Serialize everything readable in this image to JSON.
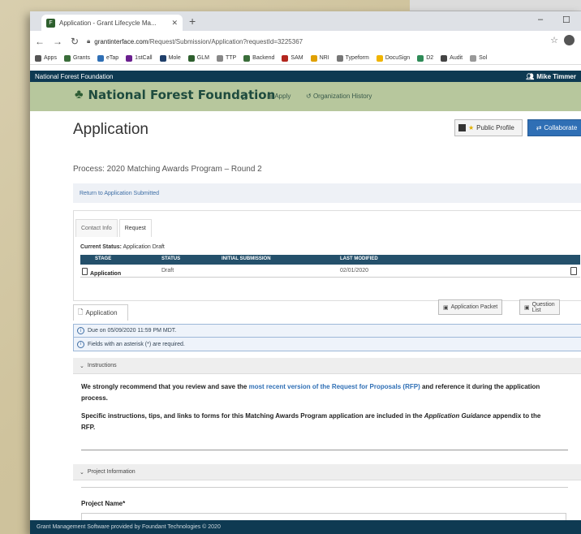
{
  "browser": {
    "tab_title": "Application - Grant Lifecycle Ma...",
    "url_host": "grantinterface.com",
    "url_path": "/Request/Submission/Application?requestId=3225367",
    "bookmarks": [
      {
        "label": "Apps",
        "color": "#555555"
      },
      {
        "label": "Grants",
        "color": "#3a6d3a"
      },
      {
        "label": "eTap",
        "color": "#2f6fb5"
      },
      {
        "label": "1stCall",
        "color": "#6a1f8f"
      },
      {
        "label": "Mole",
        "color": "#1f3f6a"
      },
      {
        "label": "GLM",
        "color": "#2e5f2e"
      },
      {
        "label": "TTP",
        "color": "#888888"
      },
      {
        "label": "Backend",
        "color": "#3a6d3a"
      },
      {
        "label": "SAM",
        "color": "#b3261e"
      },
      {
        "label": "NRI",
        "color": "#e0a000"
      },
      {
        "label": "Typeform",
        "color": "#777777"
      },
      {
        "label": "DocuSign",
        "color": "#f0b400"
      },
      {
        "label": "D2",
        "color": "#2e8b57"
      },
      {
        "label": "Audit",
        "color": "#444444"
      },
      {
        "label": "Sol",
        "color": "#999999"
      }
    ]
  },
  "app": {
    "org_label": "National Forest Foundation",
    "user_name": "Mike Timmer",
    "brand": "National Forest Foundation",
    "nav": {
      "apply": "Apply",
      "history": "Organization History"
    }
  },
  "page": {
    "title": "Application",
    "public_profile": "Public Profile",
    "collaborate": "Collaborate",
    "process": "Process: 2020 Matching Awards Program – Round 2",
    "return_link": "Return to Application Submitted",
    "tabs": [
      "Contact Info",
      "Request"
    ],
    "status_label": "Current Status:",
    "status_value": "Application Draft",
    "table": {
      "headers": [
        "STAGE",
        "STATUS",
        "INITIAL SUBMISSION",
        "LAST MODIFIED"
      ],
      "row": {
        "stage": "Application",
        "status": "Draft",
        "initial": "",
        "modified": "02/01/2020"
      }
    },
    "app_tab": "Application",
    "app_packet": "Application Packet",
    "question_list": "Question List",
    "due": "Due on 05/09/2020 11:59 PM MDT.",
    "required": "Fields with an asterisk (*) are required.",
    "instructions_hdr": "Instructions",
    "instr_p1_a": "We strongly recommend that you review and save the ",
    "instr_p1_link": "most recent version of the Request for Proposals (RFP)",
    "instr_p1_b": " and reference it during the application process.",
    "instr_p2_a": "Specific instructions, tips, and links to forms for this Matching Awards Program application are included in the ",
    "instr_p2_em": "Application Guidance",
    "instr_p2_b": " appendix to the RFP.",
    "project_hdr": "Project Information",
    "project_name_label": "Project Name*"
  },
  "footer": "Grant Management Software provided by Foundant Technologies © 2020"
}
